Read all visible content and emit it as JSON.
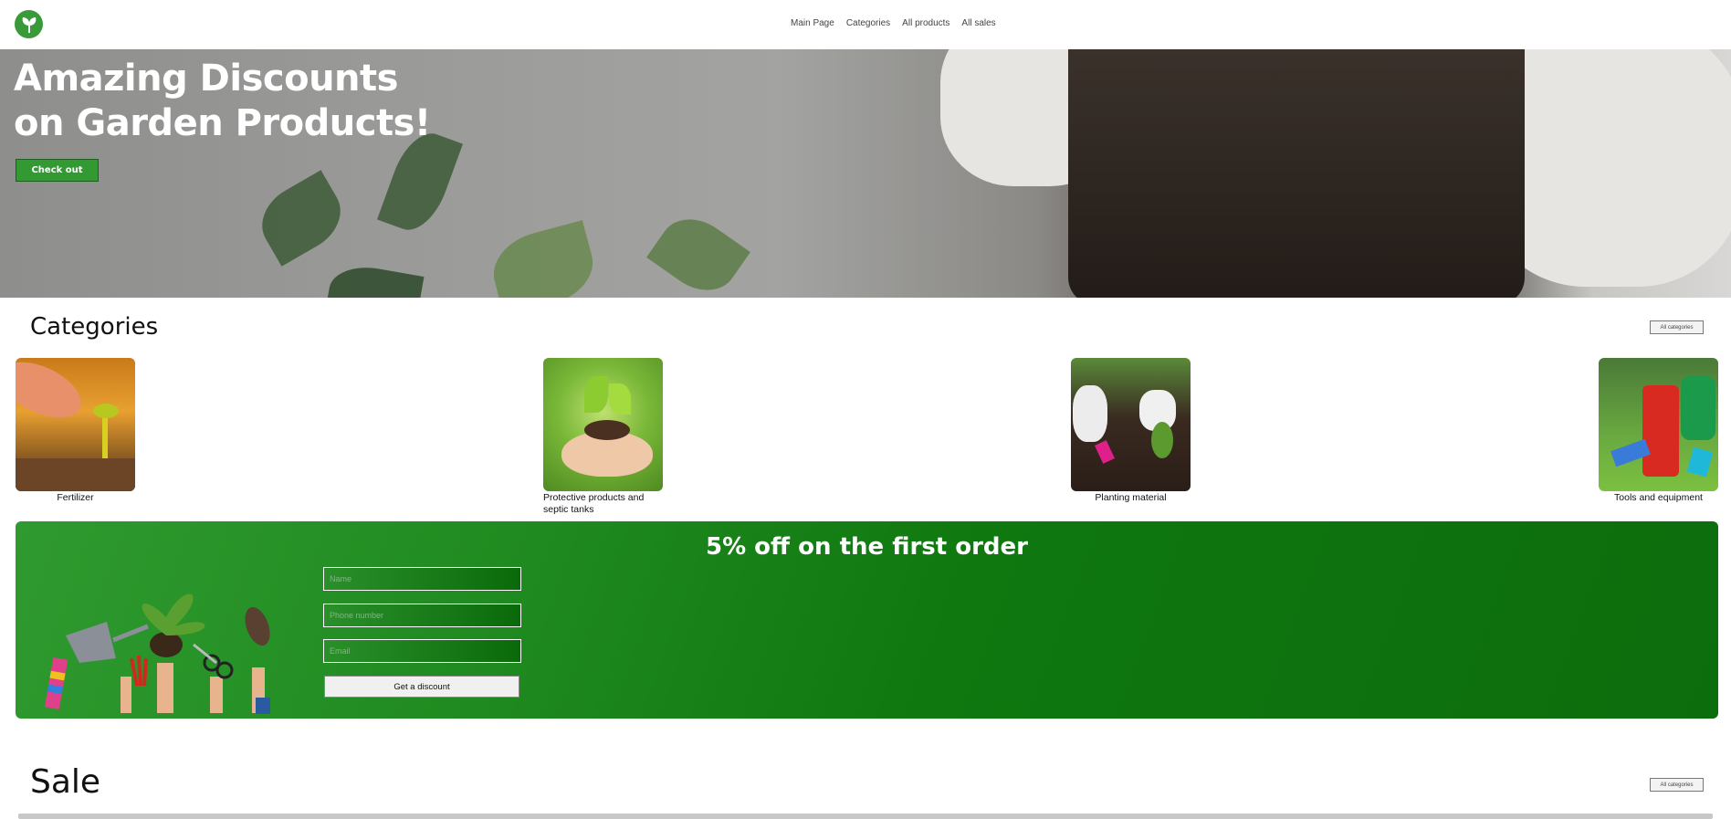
{
  "header": {
    "nav": [
      "Main Page",
      "Categories",
      "All products",
      "All sales"
    ]
  },
  "hero": {
    "title_line1": "Amazing Discounts",
    "title_line2": "on Garden Products!",
    "button_label": "Check out"
  },
  "categories": {
    "title": "Categories",
    "all_button": "All categories",
    "items": [
      {
        "label": "Fertilizer"
      },
      {
        "label": "Protective products and septic tanks"
      },
      {
        "label": "Planting material"
      },
      {
        "label": "Tools and equipment"
      }
    ]
  },
  "discount": {
    "title": "5% off on the first order",
    "fields": [
      {
        "placeholder": "Name"
      },
      {
        "placeholder": "Phone number"
      },
      {
        "placeholder": "Email"
      }
    ],
    "button_label": "Get a discount"
  },
  "sale": {
    "title": "Sale",
    "all_button": "All categories"
  },
  "colors": {
    "brand_green": "#339933",
    "banner_dark_green": "#0c6d0c"
  },
  "icons": {
    "logo": "leaf-sprout-icon"
  }
}
